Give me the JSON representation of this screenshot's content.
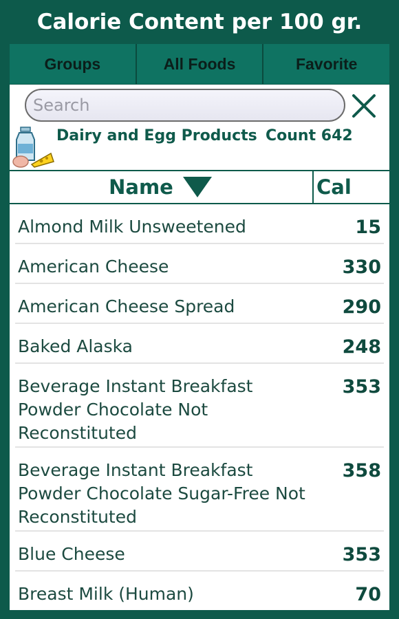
{
  "header": {
    "title": "Calorie Content per 100 gr."
  },
  "tabs": [
    {
      "label": "Groups"
    },
    {
      "label": "All Foods"
    },
    {
      "label": "Favorite"
    }
  ],
  "search": {
    "placeholder": "Search",
    "value": ""
  },
  "group": {
    "name": "Dairy and Egg Products",
    "count_label": "Count 642",
    "icon": "dairy-icon"
  },
  "table": {
    "name_header": "Name",
    "cal_header": "Cal",
    "sort": "descending-arrow"
  },
  "foods": [
    {
      "name": "Almond Milk Unsweetened",
      "cal": "15"
    },
    {
      "name": "American Cheese",
      "cal": "330"
    },
    {
      "name": "American Cheese Spread",
      "cal": "290"
    },
    {
      "name": "Baked Alaska",
      "cal": "248"
    },
    {
      "name": "Beverage Instant Breakfast Powder Chocolate Not Reconstituted",
      "cal": "353"
    },
    {
      "name": "Beverage Instant Breakfast Powder Chocolate Sugar-Free Not Reconstituted",
      "cal": "358"
    },
    {
      "name": "Blue Cheese",
      "cal": "353"
    },
    {
      "name": "Breast Milk (Human)",
      "cal": "70"
    }
  ],
  "colors": {
    "background": "#0d5a4b",
    "tab": "#0f7362",
    "accent_text": "#0f5a4b"
  }
}
